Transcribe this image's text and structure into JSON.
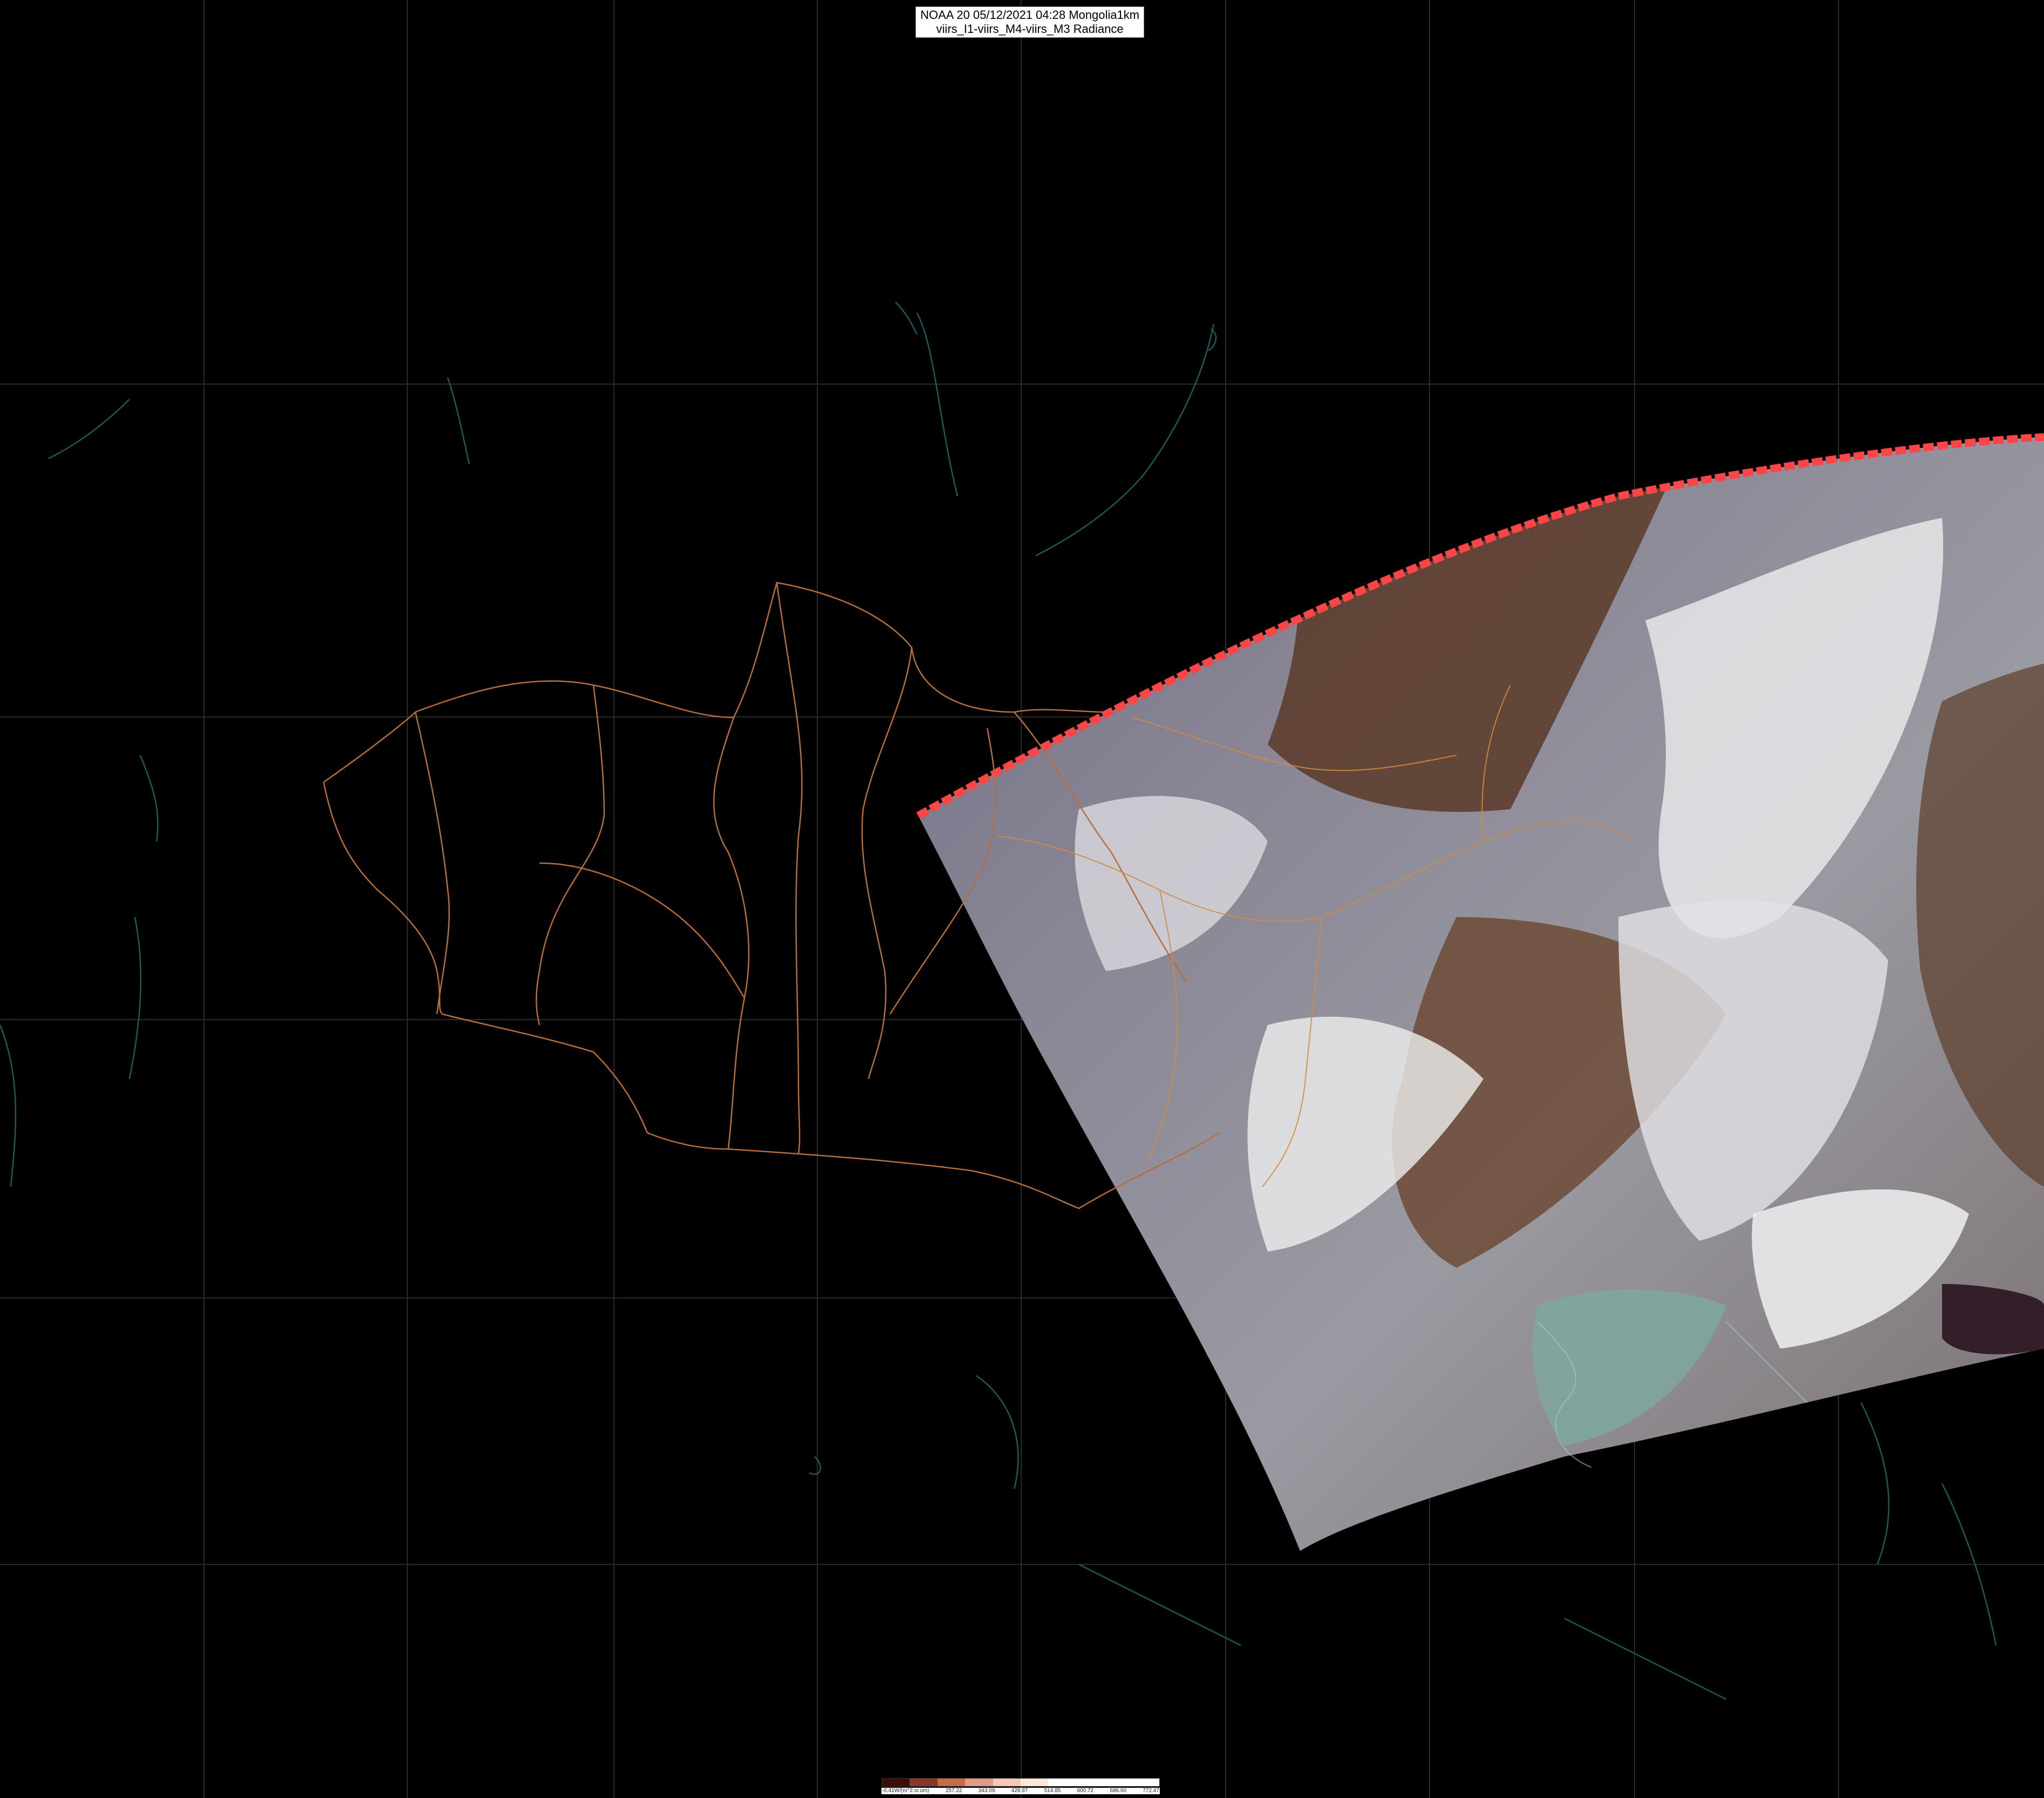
{
  "title": {
    "line1": "NOAA 20 05/12/2021 04:28 Mongolia1km",
    "line2": "viirs_I1-viirs_M4-viirs_M3 Radiance"
  },
  "colors": {
    "background": "#000000",
    "graticule": "#2a2a2a",
    "coastline": "#1f5a5a",
    "province_border": "#b5703a",
    "swath_edge": "#ff4545"
  },
  "legend": {
    "colors": [
      "#3a0f08",
      "#8a3a22",
      "#c86a48",
      "#e89a80",
      "#f4c8b8",
      "#fbe6dc",
      "#ffffff",
      "#ffffff",
      "#ffffff",
      "#ffffff"
    ],
    "labels": [
      "-0.41W/(m^2.sr.um)",
      "257.22",
      "343.09",
      "428.97",
      "514.85",
      "600.72",
      "686.60",
      "772.47"
    ]
  }
}
